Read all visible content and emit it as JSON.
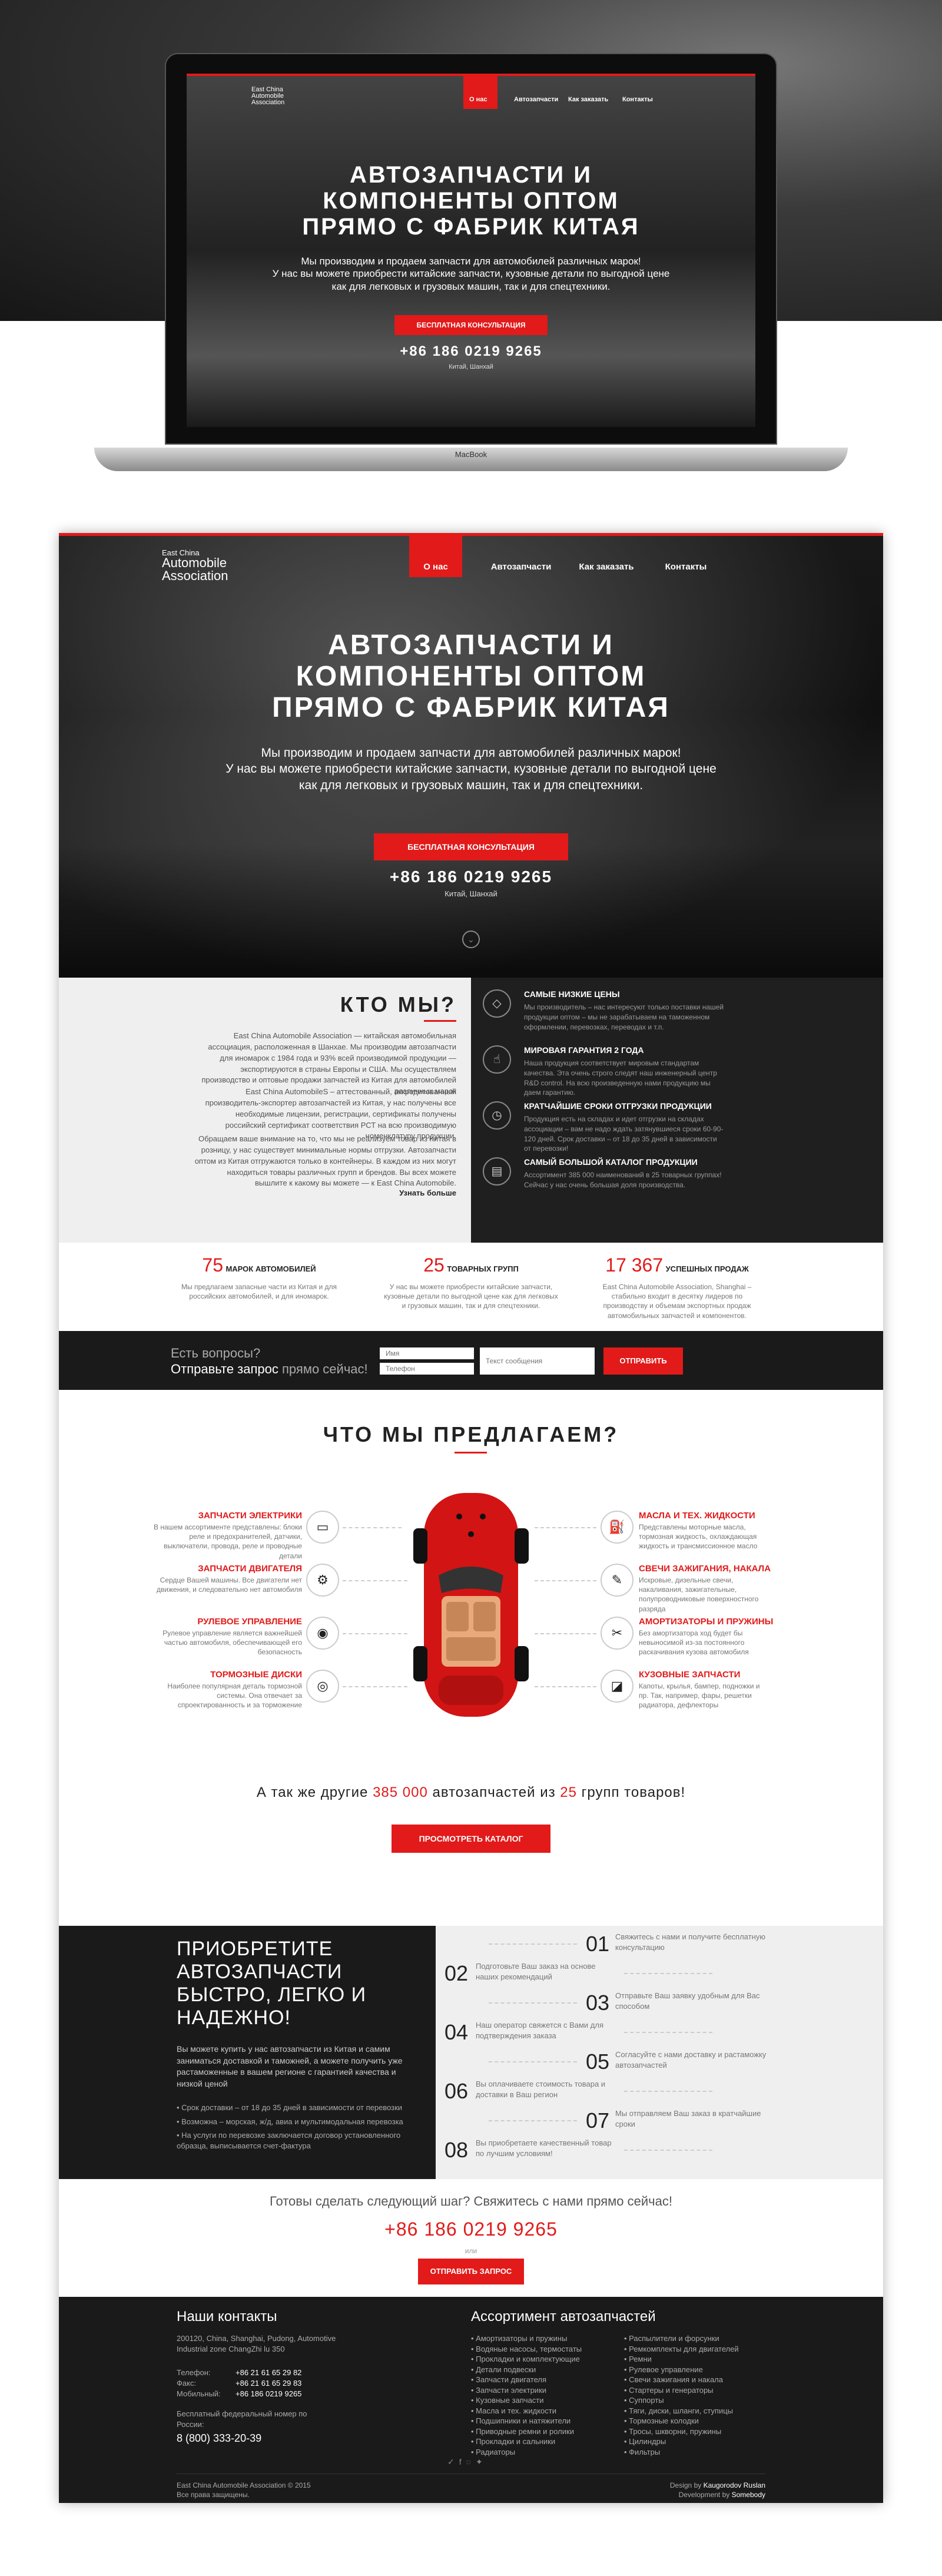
{
  "nav": {
    "items": [
      "О нас",
      "Автозапчасти",
      "Как заказать",
      "Контакты"
    ]
  },
  "logo": {
    "line1": "East China",
    "line2": "Automobile",
    "line3": "Association"
  },
  "hero": {
    "title_lines": [
      "АВТОЗАПЧАСТИ И",
      "КОМПОНЕНТЫ ОПТОМ",
      "ПРЯМО С ФАБРИК КИТАЯ"
    ],
    "sub_lines": [
      "Мы производим и продаем запчасти для автомобилей различных марок!",
      "У нас вы можете приобрести китайские запчасти, кузовные детали по выгодной цене",
      "как для легковых и грузовых машин, так и для спецтехники."
    ],
    "button": "БЕСПЛАТНАЯ КОНСУЛЬТАЦИЯ",
    "phone": "+86 186 0219 9265",
    "location": "Китай, Шанхай"
  },
  "laptop": {
    "brand": "MacBook"
  },
  "about": {
    "title": "КТО МЫ?",
    "p1": "East China Automobile Association — китайская автомобильная ассоциация, расположенная в Шанхае. Мы производим автозапчасти для иномарок с 1984 года и 93% всей производимой продукции — экспортируются в страны Европы и США. Мы осуществляем производство и оптовые продажи запчастей из Китая для автомобилей различных марок",
    "p2": "East China AutomobileS – аттестованный, аккредитованный производитель-экспортер автозапчастей из Китая, у нас получены все необходимые лицензии, регистрации, сертификаты получены российский сертификат соответствия РСТ на всю производимую номенклатуру продукции.",
    "p3": "Обращаем ваше внимание на то, что мы не реализуем товар из Китая в розницу, у нас существует минимальные нормы отгрузки. Автозапчасти оптом из Китая отгружаются только в контейнеры. В каждом из них могут находиться товары различных групп и брендов. Вы всех можете вышлите к какому вы можете — к East China Automobile.",
    "more": "Узнать больше"
  },
  "features": [
    {
      "title": "САМЫЕ НИЗКИЕ ЦЕНЫ",
      "desc": "Мы производитель – нас интересуют только поставки нашей продукции оптом – мы не зарабатываем на таможенном оформлении, перевозках, переводах и т.п.",
      "icon": "tag-icon",
      "glyph": "◇"
    },
    {
      "title": "МИРОВАЯ ГАРАНТИЯ 2 ГОДА",
      "desc": "Наша продукция соответствует мировым стандартам качества. Эта очень строго следят наш инженерный центр R&D control. На всю произведенную нами продукцию мы даем гарантию.",
      "icon": "thumb-icon",
      "glyph": "☝"
    },
    {
      "title": "КРАТЧАЙШИЕ СРОКИ ОТГРУЗКИ ПРОДУКЦИИ",
      "desc": "Продукция есть на складах и идет отгрузки на складах ассоциации – вам не надо ждать затянувшиеся сроки 60-90-120 дней. Срок доставки – от 18 до 35 дней в зависимости от перевозки!",
      "icon": "clock-icon",
      "glyph": "◷"
    },
    {
      "title": "САМЫЙ БОЛЬШОЙ КАТАЛОГ ПРОДУКЦИИ",
      "desc": "Ассортимент 385 000 наименований в 25 товарных группах! Сейчас у нас очень большая доля производства.",
      "icon": "book-icon",
      "glyph": "▤"
    }
  ],
  "stats": [
    {
      "num": "75",
      "label": "МАРОК АВТОМОБИЛЕЙ",
      "desc": "Мы предлагаем запасные части из Китая и для российских автомобилей, и для иномарок."
    },
    {
      "num": "25",
      "label": "ТОВАРНЫХ ГРУПП",
      "desc": "У нас вы можете приобрести китайские запчасти, кузовные детали по выгодной цене как для легковых и грузовых машин, так и для спецтехники."
    },
    {
      "num": "17 367",
      "label": "УСПЕШНЫХ ПРОДАЖ",
      "desc": "East China Automobile Association, Shanghai – стабильно входит в десятку лидеров по производству и объемам экспортных продаж автомобильных запчастей и компонентов."
    }
  ],
  "question": {
    "line1": "Есть вопросы?",
    "line2": "Отправьте запрос",
    "line2b": "прямо сейчас!",
    "name_ph": "Имя",
    "phone_ph": "Телефон",
    "msg_ph": "Текст сообщения",
    "button": "ОТПРАВИТЬ"
  },
  "offer": {
    "title": "ЧТО МЫ ПРЕДЛАГАЕМ?",
    "left": [
      {
        "title": "ЗАПЧАСТИ ЭЛЕКТРИКИ",
        "desc": "В нашем ассортименте представлены: блоки реле и предохранителей, датчики, выключатели, провода, реле и проводные детали",
        "icon": "battery-icon",
        "glyph": "▭"
      },
      {
        "title": "ЗАПЧАСТИ ДВИГАТЕЛЯ",
        "desc": "Сердце Вашей машины. Все двигатели нет движения, и следовательно нет автомобиля",
        "icon": "engine-icon",
        "glyph": "⚙"
      },
      {
        "title": "РУЛЕВОЕ УПРАВЛЕНИЕ",
        "desc": "Рулевое управление является важнейшей частью автомобиля, обеспечивающей его безопасность",
        "icon": "steering-icon",
        "glyph": "◉"
      },
      {
        "title": "ТОРМОЗНЫЕ ДИСКИ",
        "desc": "Наиболее популярная деталь тормозной системы. Она отвечает за спроектированность и за торможение",
        "icon": "brake-icon",
        "glyph": "◎"
      }
    ],
    "right": [
      {
        "title": "МАСЛА И ТЕХ. ЖИДКОСТИ",
        "desc": "Представлены моторные масла, тормозная жидкость, охлаждающая жидкость и трансмиссионное масло",
        "icon": "oil-icon",
        "glyph": "⛽"
      },
      {
        "title": "СВЕЧИ ЗАЖИГАНИЯ, НАКАЛА",
        "desc": "Искровые, дизельные свечи, накаливания, зажигательные, полупроводниковые поверхностного разряда",
        "icon": "plug-icon",
        "glyph": "✎"
      },
      {
        "title": "АМОРТИЗАТОРЫ И ПРУЖИНЫ",
        "desc": "Без амортизатора ход будет бы невыносимой из-за постоянного раскачивания кузова автомобиля",
        "icon": "shock-icon",
        "glyph": "✂"
      },
      {
        "title": "КУЗОВНЫЕ ЗАПЧАСТИ",
        "desc": "Капоты, крылья, бампер, подножки и пр. Так, например, фары, решетки радиатора, дефлекторы",
        "icon": "door-icon",
        "glyph": "◪"
      }
    ],
    "also_prefix": "А так же другие",
    "also_num1": "385 000",
    "also_mid": "автозапчастей из",
    "also_num2": "25",
    "also_suffix": "групп товаров!",
    "catalog_button": "ПРОСМОТРЕТЬ КАТАЛОГ"
  },
  "steps": {
    "title_lines": [
      "ПРИОБРЕТИТЕ",
      "АВТОЗАПЧАСТИ",
      "БЫСТРО, ЛЕГКО И",
      "НАДЕЖНО!"
    ],
    "intro": "Вы можете купить у нас автозапчасти из Китая и самим заниматься доставкой и таможней, а можете получить уже растаможенные в вашем регионе с гарантией качества и низкой ценой",
    "bullets": [
      "Срок доставки – от 18 до 35 дней в зависимости от перевозки",
      "Возможна – морская, ж/д, авиа и мультимодальная перевозка",
      "На услуги по перевозке заключается договор установленного образца, выписывается счет-фактура"
    ],
    "items": [
      {
        "n": "01",
        "t": "Свяжитесь с нами и получите бесплатную консультацию"
      },
      {
        "n": "02",
        "t": "Подготовьте Ваш заказ на основе наших рекомендаций"
      },
      {
        "n": "03",
        "t": "Отправьте Ваш заявку удобным для Вас способом"
      },
      {
        "n": "04",
        "t": "Наш оператор свяжется с Вами для подтверждения заказа"
      },
      {
        "n": "05",
        "t": "Согласуйте с нами доставку и растаможку автозапчастей"
      },
      {
        "n": "06",
        "t": "Вы оплачиваете стоимость товара и доставки в Ваш регион"
      },
      {
        "n": "07",
        "t": "Мы отправляем Ваш заказ в кратчайшие сроки"
      },
      {
        "n": "08",
        "t": "Вы приобретаете качественный товар по лучшим условиям!"
      }
    ]
  },
  "cta": {
    "text": "Готовы сделать следующий шаг? Свяжитесь с нами прямо сейчас!",
    "phone": "+86 186 0219 9265",
    "or": "или",
    "button": "ОТПРАВИТЬ ЗАПРОС"
  },
  "footer": {
    "contacts_title": "Наши контакты",
    "address": "200120, China, Shanghai, Pudong, Automotive Industrial zone ChangZhi lu 350",
    "tel_label": "Телефон:",
    "tel": "+86 21 61 65 29 82",
    "fax_label": "Факс:",
    "fax": "+86 21 61 65 29 83",
    "mob_label": "Мобильный:",
    "mob": "+86 186 0219 9265",
    "fed_label": "Бесплатный федеральный номер по России:",
    "fed": "8 (800) 333-20-39",
    "assort_title": "Ассортимент автозапчастей",
    "col1": [
      "Амортизаторы и пружины",
      "Водяные насосы, термостаты",
      "Прокладки и комплектующие",
      "Детали подвески",
      "Запчасти двигателя",
      "Запчасти электрики",
      "Кузовные запчасти",
      "Масла и тех. жидкости",
      "Подшипники и натяжители",
      "Приводные ремни и ролики",
      "Прокладки и сальники",
      "Радиаторы"
    ],
    "col2": [
      "Распылители и форсунки",
      "Ремкомплекты для двигателей",
      "Ремни",
      "Рулевое управление",
      "Свечи зажигания и накала",
      "Стартеры и генераторы",
      "Суппорты",
      "Тяги, диски, шланги, ступицы",
      "Тормозные колодки",
      "Тросы, шкворни, пружины",
      "Цилиндры",
      "Фильтры"
    ],
    "copyright1": "East China Automobile Association © 2015",
    "copyright2": "Все права защищены.",
    "design1": "Design by",
    "design1b": "Kaugorodov Ruslan",
    "design2": "Development by",
    "design2b": "Somebody"
  },
  "colors": {
    "accent": "#e21a1a",
    "dark": "#1a1a1a"
  }
}
